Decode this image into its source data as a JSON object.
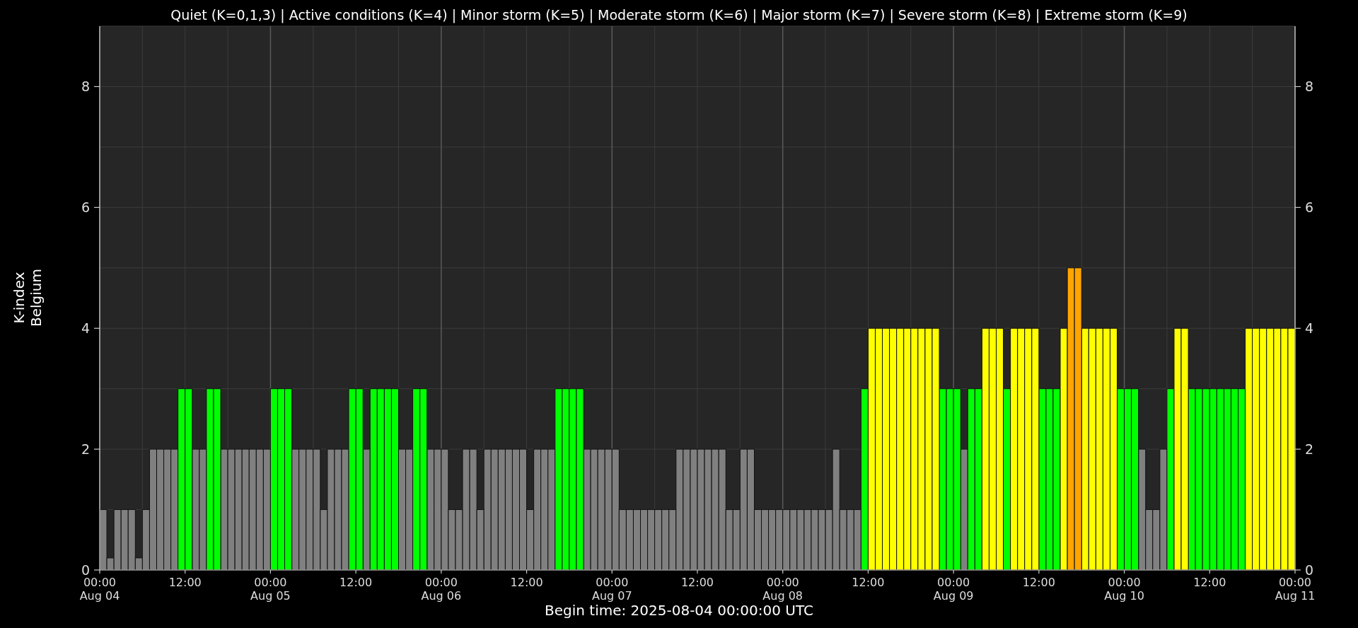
{
  "chart_data": {
    "type": "bar",
    "title": "Quiet (K=0,1,3) | Active conditions (K=4) | Minor storm (K=5) | Moderate storm (K=6) | Major storm (K=7) | Severe storm (K=8) | Extreme storm (K=9)",
    "xlabel": "Begin time: 2025-08-04 00:00:00 UTC",
    "ylabel": "K-index\nBelgium",
    "grid": true,
    "ylim": [
      0,
      9
    ],
    "y2lim": [
      0,
      9
    ],
    "yticks": [
      0,
      2,
      4,
      6,
      8
    ],
    "y2ticks": [
      0,
      2,
      4,
      6,
      8
    ],
    "categories": [
      "00:00\nAug 04",
      null,
      null,
      null,
      null,
      null,
      null,
      null,
      null,
      null,
      null,
      null,
      "12:00",
      null,
      null,
      null,
      null,
      null,
      null,
      null,
      null,
      null,
      null,
      null,
      "00:00\nAug 05",
      null,
      null,
      null,
      null,
      null,
      null,
      null,
      null,
      null,
      null,
      null,
      "12:00",
      null,
      null,
      null,
      null,
      null,
      null,
      null,
      null,
      null,
      null,
      null,
      "00:00\nAug 06",
      null,
      null,
      null,
      null,
      null,
      null,
      null,
      null,
      null,
      null,
      null,
      "12:00",
      null,
      null,
      null,
      null,
      null,
      null,
      null,
      null,
      null,
      null,
      null,
      "00:00\nAug 07",
      null,
      null,
      null,
      null,
      null,
      null,
      null,
      null,
      null,
      null,
      null,
      "12:00",
      null,
      null,
      null,
      null,
      null,
      null,
      null,
      null,
      null,
      null,
      null,
      "00:00\nAug 08",
      null,
      null,
      null,
      null,
      null,
      null,
      null,
      null,
      null,
      null,
      null,
      "12:00",
      null,
      null,
      null,
      null,
      null,
      null,
      null,
      null,
      null,
      null,
      null,
      "00:00\nAug 09",
      null,
      null,
      null,
      null,
      null,
      null,
      null,
      null,
      null,
      null,
      null,
      "12:00",
      null,
      null,
      null,
      null,
      null,
      null,
      null,
      null,
      null,
      null,
      null,
      "00:00\nAug 10",
      null,
      null,
      null,
      null,
      null,
      null,
      null,
      null,
      null,
      null,
      null,
      "12:00",
      null,
      null,
      null,
      null,
      null,
      null,
      null,
      null,
      null,
      null,
      null,
      "00:00\nAug 11"
    ],
    "series": [
      {
        "color": "#808080",
        "values": [
          1,
          0.2,
          1,
          1,
          1,
          0.2,
          1,
          2,
          2,
          2,
          2,
          null,
          null,
          2,
          2,
          null,
          null,
          2,
          2,
          2,
          2,
          2,
          2,
          2,
          null,
          null,
          null,
          2,
          2,
          2,
          2,
          1,
          2,
          2,
          2,
          null,
          null,
          2,
          null,
          null,
          null,
          null,
          2,
          2,
          null,
          null,
          2,
          2,
          2,
          1,
          1,
          2,
          2,
          1,
          2,
          2,
          2,
          2,
          2,
          2,
          1,
          2,
          2,
          2,
          null,
          null,
          null,
          null,
          2,
          2,
          2,
          2,
          2,
          1,
          1,
          1,
          1,
          1,
          1,
          1,
          1,
          2,
          2,
          2,
          2,
          2,
          2,
          2,
          1,
          1,
          2,
          2,
          1,
          1,
          1,
          1,
          1,
          1,
          1,
          1,
          1,
          1,
          1,
          2,
          1,
          1,
          1,
          null,
          null,
          null,
          null,
          null,
          null,
          null,
          null,
          null,
          null,
          null,
          null,
          null,
          null,
          2,
          null,
          null,
          null,
          null,
          null,
          null,
          null,
          null,
          null,
          null,
          null,
          null,
          null,
          null,
          null,
          null,
          null,
          null,
          null,
          null,
          null,
          null,
          null,
          null,
          2,
          1,
          1,
          2,
          null,
          null,
          null,
          null,
          null,
          null,
          null,
          null,
          null,
          null,
          null,
          null,
          null,
          null,
          null,
          null,
          null,
          null,
          null
        ]
      },
      {
        "color": "#00ff00",
        "values": [
          null,
          null,
          null,
          null,
          null,
          null,
          null,
          null,
          null,
          null,
          null,
          3,
          3,
          null,
          null,
          3,
          3,
          null,
          null,
          null,
          null,
          null,
          null,
          null,
          3,
          3,
          3,
          null,
          null,
          null,
          null,
          null,
          null,
          null,
          null,
          3,
          3,
          null,
          3,
          3,
          3,
          3,
          null,
          null,
          3,
          3,
          null,
          null,
          null,
          null,
          null,
          null,
          null,
          null,
          null,
          null,
          null,
          null,
          null,
          null,
          null,
          null,
          null,
          null,
          3,
          3,
          3,
          3,
          null,
          null,
          null,
          null,
          null,
          null,
          null,
          null,
          null,
          null,
          null,
          null,
          null,
          null,
          null,
          null,
          null,
          null,
          null,
          null,
          null,
          null,
          null,
          null,
          null,
          null,
          null,
          null,
          null,
          null,
          null,
          null,
          null,
          null,
          null,
          null,
          null,
          null,
          null,
          3,
          null,
          null,
          null,
          null,
          null,
          null,
          null,
          null,
          null,
          null,
          3,
          3,
          3,
          null,
          3,
          3,
          null,
          null,
          null,
          3,
          null,
          null,
          null,
          null,
          3,
          3,
          3,
          null,
          null,
          null,
          null,
          null,
          null,
          null,
          null,
          3,
          3,
          3,
          null,
          null,
          null,
          null,
          3,
          null,
          null,
          3,
          3,
          3,
          3,
          3,
          3,
          3,
          3,
          null,
          null,
          null,
          null,
          null,
          null,
          null,
          null
        ]
      },
      {
        "color": "#ffff00",
        "values": [
          null,
          null,
          null,
          null,
          null,
          null,
          null,
          null,
          null,
          null,
          null,
          null,
          null,
          null,
          null,
          null,
          null,
          null,
          null,
          null,
          null,
          null,
          null,
          null,
          null,
          null,
          null,
          null,
          null,
          null,
          null,
          null,
          null,
          null,
          null,
          null,
          null,
          null,
          null,
          null,
          null,
          null,
          null,
          null,
          null,
          null,
          null,
          null,
          null,
          null,
          null,
          null,
          null,
          null,
          null,
          null,
          null,
          null,
          null,
          null,
          null,
          null,
          null,
          null,
          null,
          null,
          null,
          null,
          null,
          null,
          null,
          null,
          null,
          null,
          null,
          null,
          null,
          null,
          null,
          null,
          null,
          null,
          null,
          null,
          null,
          null,
          null,
          null,
          null,
          null,
          null,
          null,
          null,
          null,
          null,
          null,
          null,
          null,
          null,
          null,
          null,
          null,
          null,
          null,
          null,
          null,
          null,
          null,
          4,
          4,
          4,
          4,
          4,
          4,
          4,
          4,
          4,
          4,
          null,
          null,
          null,
          null,
          null,
          null,
          4,
          4,
          4,
          null,
          4,
          4,
          4,
          4,
          null,
          null,
          null,
          4,
          null,
          null,
          4,
          4,
          4,
          4,
          4,
          null,
          null,
          null,
          null,
          null,
          null,
          null,
          null,
          4,
          4,
          null,
          null,
          null,
          null,
          null,
          null,
          null,
          null,
          4,
          4,
          4,
          4,
          4,
          4,
          4,
          null
        ]
      },
      {
        "color": "#ffa500",
        "values": [
          null,
          null,
          null,
          null,
          null,
          null,
          null,
          null,
          null,
          null,
          null,
          null,
          null,
          null,
          null,
          null,
          null,
          null,
          null,
          null,
          null,
          null,
          null,
          null,
          null,
          null,
          null,
          null,
          null,
          null,
          null,
          null,
          null,
          null,
          null,
          null,
          null,
          null,
          null,
          null,
          null,
          null,
          null,
          null,
          null,
          null,
          null,
          null,
          null,
          null,
          null,
          null,
          null,
          null,
          null,
          null,
          null,
          null,
          null,
          null,
          null,
          null,
          null,
          null,
          null,
          null,
          null,
          null,
          null,
          null,
          null,
          null,
          null,
          null,
          null,
          null,
          null,
          null,
          null,
          null,
          null,
          null,
          null,
          null,
          null,
          null,
          null,
          null,
          null,
          null,
          null,
          null,
          null,
          null,
          null,
          null,
          null,
          null,
          null,
          null,
          null,
          null,
          null,
          null,
          null,
          null,
          null,
          null,
          null,
          null,
          null,
          null,
          null,
          null,
          null,
          null,
          null,
          null,
          null,
          null,
          null,
          null,
          null,
          null,
          null,
          null,
          null,
          null,
          null,
          null,
          null,
          null,
          null,
          null,
          null,
          null,
          5,
          5,
          null,
          null,
          null,
          null,
          null,
          null,
          null,
          null,
          null,
          null,
          null,
          null,
          null,
          null,
          null,
          null,
          null,
          null,
          null,
          null,
          null,
          null,
          null,
          null,
          null,
          null,
          null,
          null,
          null,
          null,
          null
        ]
      }
    ]
  }
}
